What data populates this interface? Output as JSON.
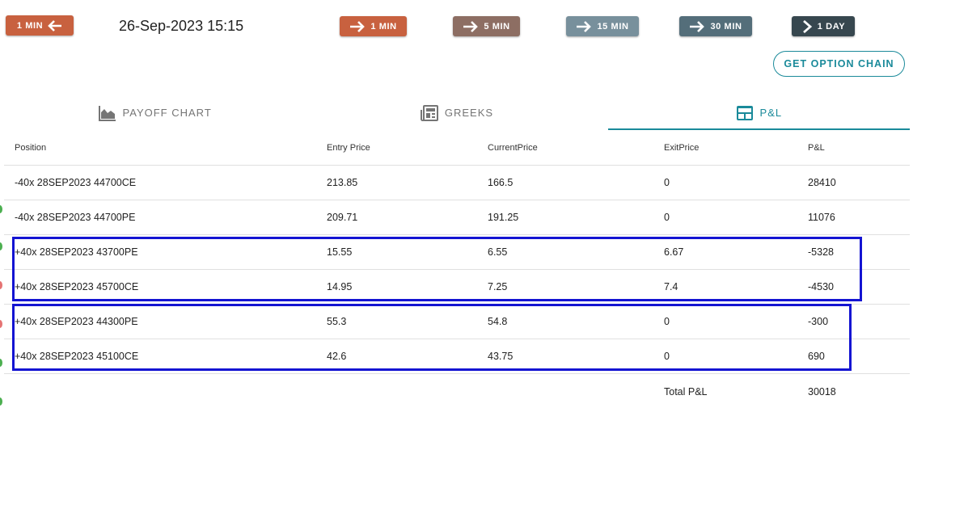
{
  "nav": {
    "back": {
      "label": "1 MIN",
      "color": "#c8613f",
      "icon": "arrow-left-icon"
    },
    "datetime": "26-Sep-2023 15:15",
    "forward": [
      {
        "label": "1 MIN",
        "color": "#c8613f",
        "icon": "arrow-right-icon"
      },
      {
        "label": "5 MIN",
        "color": "#8d6e63",
        "icon": "arrow-right-icon"
      },
      {
        "label": "15 MIN",
        "color": "#78909c",
        "icon": "arrow-right-icon"
      },
      {
        "label": "30 MIN",
        "color": "#546e7a",
        "icon": "arrow-right-icon"
      },
      {
        "label": "1 DAY",
        "color": "#37474f",
        "icon": "chevron-right-icon"
      }
    ]
  },
  "option_chain_label": "GET OPTION CHAIN",
  "tabs": [
    {
      "label": "PAYOFF CHART",
      "icon": "area-chart-icon"
    },
    {
      "label": "GREEKS",
      "icon": "newspaper-icon"
    },
    {
      "label": "P&L",
      "icon": "table-icon",
      "active": true
    }
  ],
  "accent_color": "#1a8a9a",
  "highlight_color": "#1414d2",
  "table": {
    "headers": [
      "Position",
      "Entry Price",
      "CurrentPrice",
      "ExitPrice",
      "P&L"
    ],
    "rows": [
      [
        "-40x 28SEP2023 44700CE",
        "213.85",
        "166.5",
        "0",
        "28410"
      ],
      [
        "-40x 28SEP2023 44700PE",
        "209.71",
        "191.25",
        "0",
        "11076"
      ],
      [
        "+40x 28SEP2023 43700PE",
        "15.55",
        "6.55",
        "6.67",
        "-5328"
      ],
      [
        "+40x 28SEP2023 45700CE",
        "14.95",
        "7.25",
        "7.4",
        "-4530"
      ],
      [
        "+40x 28SEP2023 44300PE",
        "55.3",
        "54.8",
        "0",
        "-300"
      ],
      [
        "+40x 28SEP2023 45100CE",
        "42.6",
        "43.75",
        "0",
        "690"
      ]
    ],
    "total_label": "Total P&L",
    "total_value": "30018"
  }
}
